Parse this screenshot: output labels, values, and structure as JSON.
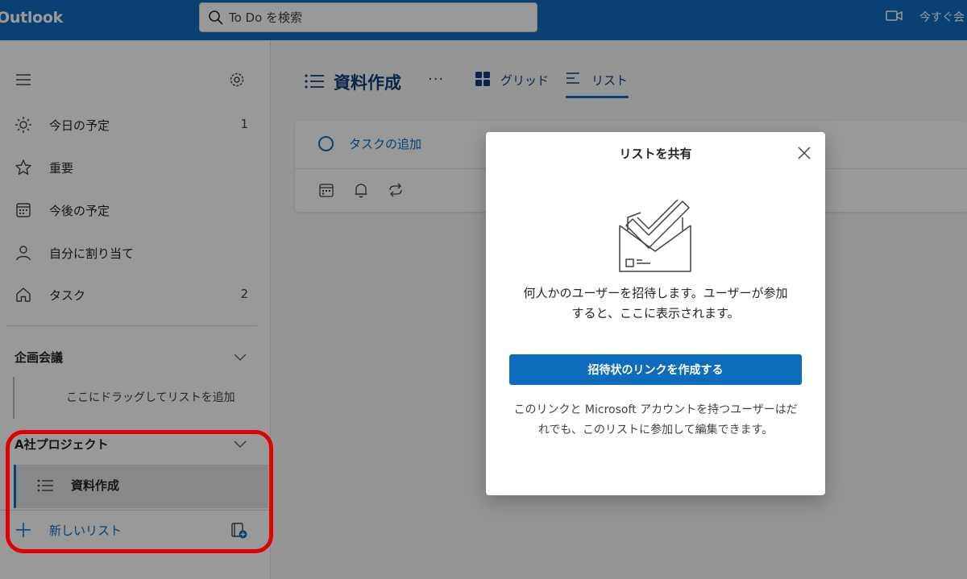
{
  "topbar": {
    "app_name": "Outlook",
    "search_placeholder": "To Do を検索",
    "meet_now": "今すぐ会"
  },
  "sidebar": {
    "items": [
      {
        "label": "今日の予定",
        "count": "1",
        "icon": "sun-icon"
      },
      {
        "label": "重要",
        "count": "",
        "icon": "star-icon"
      },
      {
        "label": "今後の予定",
        "count": "",
        "icon": "calendar-icon"
      },
      {
        "label": "自分に割り当て",
        "count": "",
        "icon": "person-icon"
      },
      {
        "label": "タスク",
        "count": "2",
        "icon": "home-icon"
      }
    ],
    "groups": [
      {
        "title": "企画会議",
        "empty_hint": "ここにドラッグしてリストを追加"
      },
      {
        "title": "A社プロジェクト",
        "lists": [
          "資料作成"
        ]
      }
    ],
    "new_list": "新しいリスト"
  },
  "main": {
    "list_title": "資料作成",
    "more": "···",
    "tabs": [
      {
        "label": "グリッド",
        "icon": "grid-icon",
        "selected": false
      },
      {
        "label": "リスト",
        "icon": "list-icon",
        "selected": true
      }
    ],
    "add_task": "タスクの追加"
  },
  "modal": {
    "title": "リストを共有",
    "description": "何人かのユーザーを招待します。ユーザーが参加すると、ここに表示されます。",
    "button": "招待状のリンクを作成する",
    "note": "このリンクと Microsoft アカウントを持つユーザーはだれでも、このリストに参加して編集できます。"
  },
  "colors": {
    "accent": "#0f6cbd",
    "highlight": "#e00000"
  }
}
